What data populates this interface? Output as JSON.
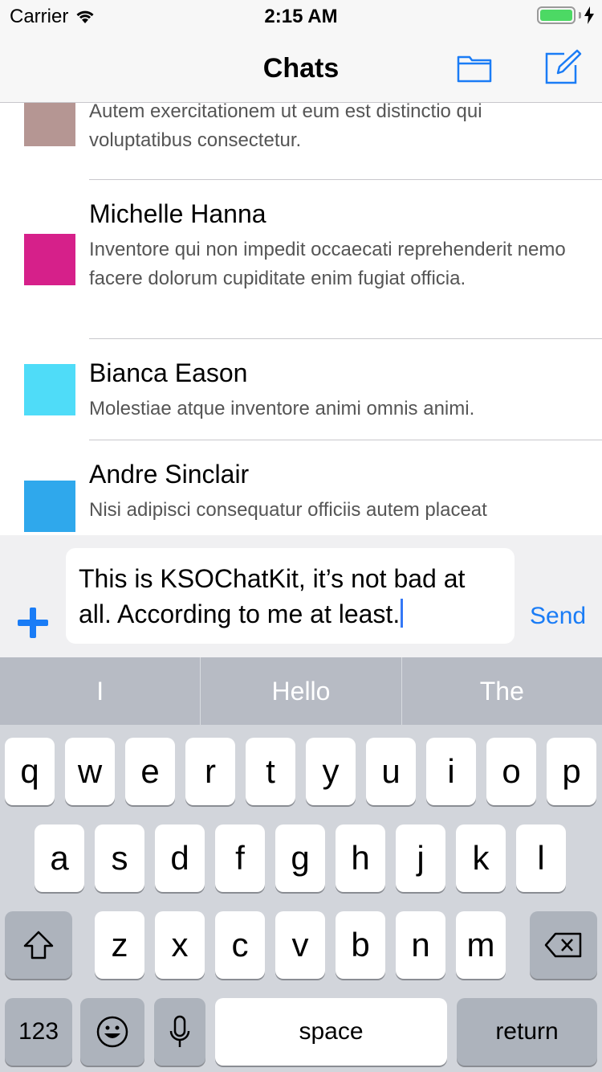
{
  "status_bar": {
    "carrier": "Carrier",
    "time": "2:15 AM"
  },
  "nav": {
    "title": "Chats",
    "left_icon": "folder-icon",
    "right_icon": "compose-icon"
  },
  "chats": [
    {
      "name": "",
      "message": "Autem exercitationem ut eum est distinctio qui voluptatibus consectetur.",
      "avatar_color": "#b59693"
    },
    {
      "name": "Michelle Hanna",
      "message": "Inventore qui non impedit occaecati reprehenderit nemo facere dolorum cupiditate enim fugiat officia.",
      "avatar_color": "#d6208a"
    },
    {
      "name": "Bianca Eason",
      "message": "Molestiae atque inventore animi omnis animi.",
      "avatar_color": "#4fdcf8"
    },
    {
      "name": "Andre Sinclair",
      "message": "Nisi adipisci consequatur officiis autem placeat",
      "avatar_color": "#2fa8ec"
    }
  ],
  "composer": {
    "text": "This is KSOChatKit, it’s not bad at all. According to me at least.",
    "send_label": "Send",
    "plus_icon": "plus-icon"
  },
  "keyboard": {
    "predictions": [
      "I",
      "Hello",
      "The"
    ],
    "row1": [
      "q",
      "w",
      "e",
      "r",
      "t",
      "y",
      "u",
      "i",
      "o",
      "p"
    ],
    "row2": [
      "a",
      "s",
      "d",
      "f",
      "g",
      "h",
      "j",
      "k",
      "l"
    ],
    "row3": [
      "z",
      "x",
      "c",
      "v",
      "b",
      "n",
      "m"
    ],
    "numbers_label": "123",
    "space_label": "space",
    "return_label": "return",
    "shift_icon": "shift-icon",
    "delete_icon": "delete-icon",
    "emoji_icon": "emoji-icon",
    "mic_icon": "microphone-icon"
  },
  "colors": {
    "accent": "#1a7cf6",
    "battery": "#4cd964"
  }
}
